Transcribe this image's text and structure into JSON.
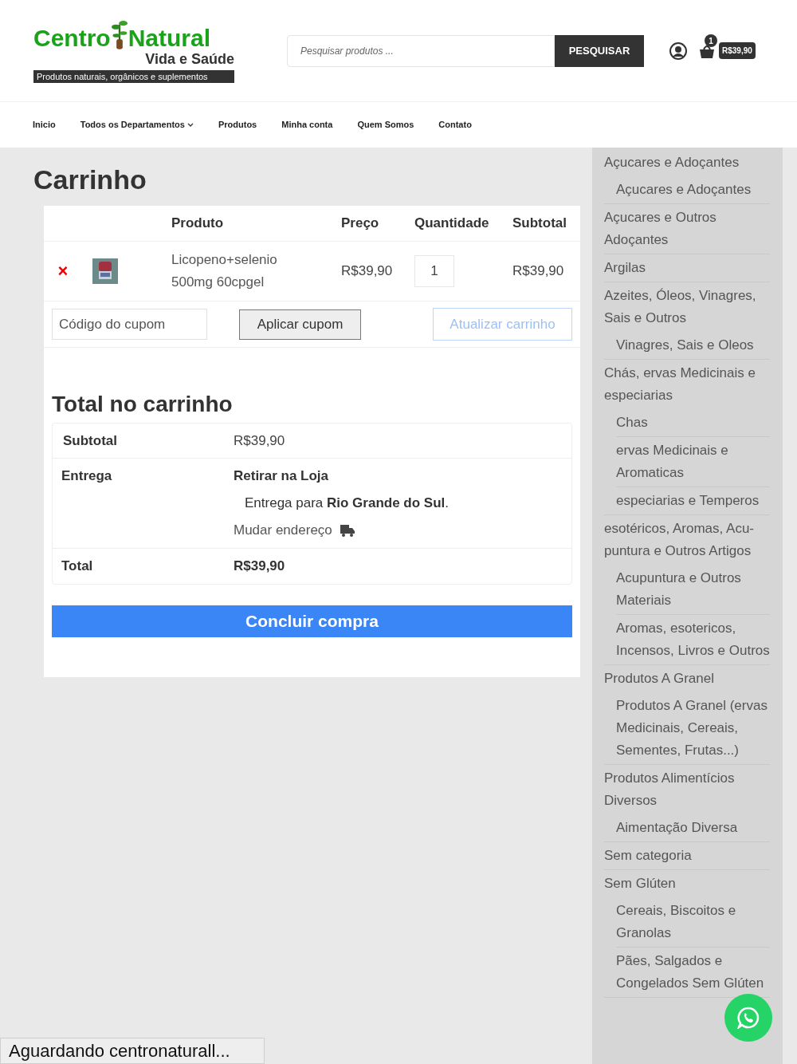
{
  "logo": {
    "name_1": "Centro",
    "name_2": "Natural",
    "subtitle": "Vida e Saúde",
    "tagline": "Produtos naturais, orgânicos e suplementos"
  },
  "search": {
    "placeholder": "Pesquisar produtos ...",
    "button": "PESQUISAR"
  },
  "cart_summary": {
    "count": "1",
    "amount": "R$39,90"
  },
  "nav": [
    {
      "label": "Inicio",
      "has_menu": false
    },
    {
      "label": "Todos os Departamentos",
      "has_menu": true
    },
    {
      "label": "Produtos",
      "has_menu": false
    },
    {
      "label": "Minha conta",
      "has_menu": false
    },
    {
      "label": "Quem Somos",
      "has_menu": false
    },
    {
      "label": "Contato",
      "has_menu": false
    }
  ],
  "page_title": "Carrinho",
  "cart_table": {
    "columns": [
      "Produto",
      "Preço",
      "Quantidade",
      "Subtotal"
    ],
    "rows": [
      {
        "remove": "×",
        "product": "Licopeno+selenio 500mg 60cpgel",
        "price": "R$39,90",
        "quantity": "1",
        "subtotal": "R$39,90"
      }
    ],
    "coupon_placeholder": "Código do cupom",
    "apply_button": "Aplicar cupom",
    "update_button": "Atualizar carrinho",
    "update_disabled": true
  },
  "totals": {
    "title": "Total no carrinho",
    "subtotal_label": "Subtotal",
    "subtotal": "R$39,90",
    "shipping_label": "Entrega",
    "shipping_method": "Retirar na Loja",
    "shipping_destination": "Entrega para **Rio Grande do Sul**.",
    "change_address": "Mudar endereço",
    "total_label": "Total",
    "total": "R$39,90",
    "checkout_button": "Concluir compra"
  },
  "sidebar": [
    {
      "label": "Açucares e Adoçantes",
      "children": [
        {
          "label": "Açucares e Adoçantes"
        }
      ]
    },
    {
      "label": "Açucares e Outros Adoçantes"
    },
    {
      "label": "Argilas"
    },
    {
      "label": "Azeites, Óleos, Vinagres, Sais e Outros",
      "children": [
        {
          "label": "Vinagres, Sais e Oleos"
        }
      ]
    },
    {
      "label": "Chás, ervas Medicinais e especiarias",
      "children": [
        {
          "label": "Chas"
        },
        {
          "label": "ervas Medicinais e Aromaticas"
        },
        {
          "label": "especiarias e Temperos"
        }
      ]
    },
    {
      "label": "esotéricos, Aromas, Acu-puntura e Outros Artigos",
      "children": [
        {
          "label": "Acupuntura e Outros Materiais"
        },
        {
          "label": "Aromas, esotericos, Incensos, Livros e Outros"
        }
      ]
    },
    {
      "label": "Produtos A Granel",
      "children": [
        {
          "label": "Produtos A Granel (ervas Medicinais, Cereais, Sementes, Frutas...)"
        }
      ]
    },
    {
      "label": "Produtos Alimentícios Diversos",
      "children": [
        {
          "label": "Aimentação Diversa"
        }
      ]
    },
    {
      "label": "Sem categoria"
    },
    {
      "label": "Sem Glúten",
      "children": [
        {
          "label": "Cereais, Biscoitos e Granolas"
        },
        {
          "label": "Pães, Salgados e Congelados Sem Glúten"
        }
      ]
    }
  ],
  "status_bar": "Aguardando centronaturall..."
}
